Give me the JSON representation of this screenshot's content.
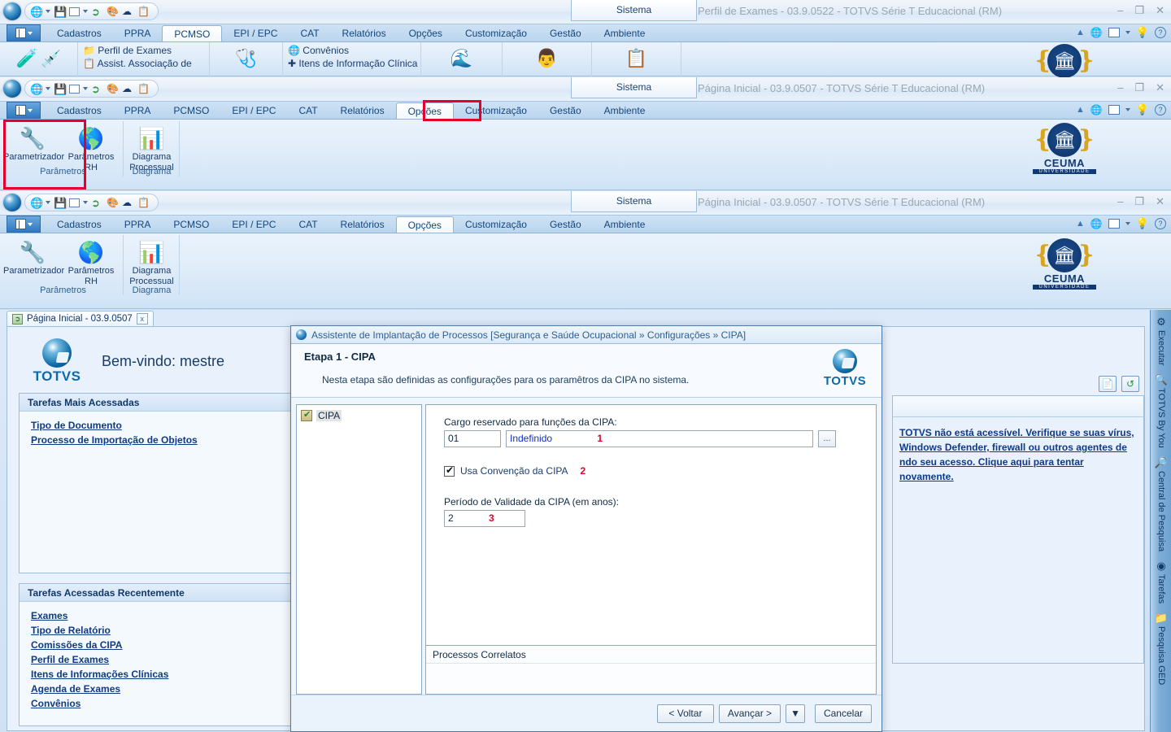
{
  "windows": [
    {
      "id": "w1",
      "title": "Perfil de Exames - 03.9.0522 - TOTVS Série T Educacional (RM)",
      "sys_tab": "Sistema",
      "tabs": [
        "Cadastros",
        "PPRA",
        "PCMSO",
        "EPI / EPC",
        "CAT",
        "Relatórios",
        "Opções",
        "Customização",
        "Gestão",
        "Ambiente"
      ],
      "active_tab": "PCMSO",
      "ribbon_items": [
        "Perfil de Exames",
        "Assist. Associação de Perfil",
        "Convênios",
        "Itens de Informação Clínica"
      ]
    },
    {
      "id": "w2",
      "title": "Página Inicial - 03.9.0507 - TOTVS Série T Educacional (RM)",
      "sys_tab": "Sistema",
      "tabs": [
        "Cadastros",
        "PPRA",
        "PCMSO",
        "EPI / EPC",
        "CAT",
        "Relatórios",
        "Opções",
        "Customização",
        "Gestão",
        "Ambiente"
      ],
      "active_tab": "Opções",
      "groups": [
        {
          "label": "Parâmetros",
          "buttons": [
            "Parametrizador",
            "Parâmetros RH"
          ]
        },
        {
          "label": "Diagrama",
          "buttons": [
            "Diagrama Processual"
          ]
        }
      ]
    },
    {
      "id": "w3",
      "title": "Página Inicial - 03.9.0507 - TOTVS Série T Educacional (RM)",
      "sys_tab": "Sistema",
      "tabs": [
        "Cadastros",
        "PPRA",
        "PCMSO",
        "EPI / EPC",
        "CAT",
        "Relatórios",
        "Opções",
        "Customização",
        "Gestão",
        "Ambiente"
      ],
      "active_tab": "Opções",
      "groups": [
        {
          "label": "Parâmetros",
          "buttons": [
            "Parametrizador",
            "Parâmetros RH"
          ]
        },
        {
          "label": "Diagrama",
          "buttons": [
            "Diagrama Processual"
          ]
        }
      ]
    }
  ],
  "brand": {
    "totvs": "TOTVS",
    "ceuma_name": "CEUMA",
    "ceuma_sub": "UNIVERSIDADE",
    "accent_blue": "#0d6ba8",
    "highlight_red": "#e4002b",
    "link_blue": "#103a86"
  },
  "workspace": {
    "doc_tab": "Página Inicial - 03.9.0507",
    "doc_tab_close": "x",
    "welcome": "Bem-vindo: mestre",
    "sections": [
      {
        "title": "Tarefas Mais Acessadas",
        "links": [
          "Tipo de Documento",
          "Processo de Importação de Objetos"
        ]
      },
      {
        "title": "Tarefas Acessadas Recentemente",
        "links": [
          "Exames",
          "Tipo de Relatório",
          "Comissões da CIPA",
          "Perfil de Exames",
          "Itens de Informações Clínicas",
          "Agenda de Exames",
          "Convênios"
        ]
      }
    ],
    "right_panel": {
      "message": "TOTVS não está acessível. Verifique se suas vírus, Windows Defender, firewall ou outros agentes de ndo seu acesso. Clique aqui para tentar novamente."
    }
  },
  "vertical_bar": {
    "items": [
      {
        "label": "Executar",
        "icon": "execute-icon"
      },
      {
        "label": "TOTVS By You",
        "icon": "magnifier-icon"
      },
      {
        "label": "Central de Pesquisa",
        "icon": "search-center-icon"
      },
      {
        "label": "Tarefas",
        "icon": "tasks-icon"
      },
      {
        "label": "Pesquisa GED",
        "icon": "ged-search-icon"
      }
    ]
  },
  "dialog": {
    "title": "Assistente de Implantação de Processos [Segurança e Saúde Ocupacional » Configurações » CIPA]",
    "step_title": "Etapa 1 - CIPA",
    "description": "Nesta etapa são definidas as configurações para os paramêtros da CIPA no sistema.",
    "tree": {
      "items": [
        "CIPA"
      ]
    },
    "fields": {
      "cargo_label": "Cargo reservado para funções da CIPA:",
      "cargo_code": "01",
      "cargo_desc": "Indefinido",
      "cargo_marker": "1",
      "ellipsis_button": "...",
      "convencao_label": "Usa Convenção da CIPA",
      "convencao_checked": true,
      "convencao_marker": "2",
      "periodo_label": "Período de Validade da CIPA (em anos):",
      "periodo_value": "2",
      "periodo_marker": "3"
    },
    "correlatos_title": "Processos Correlatos",
    "buttons": {
      "back": "< Voltar",
      "next": "Avançar >",
      "split": "▼",
      "cancel": "Cancelar"
    }
  },
  "window_controls": {
    "minimize": "–",
    "restore": "❐",
    "close": "✕"
  }
}
